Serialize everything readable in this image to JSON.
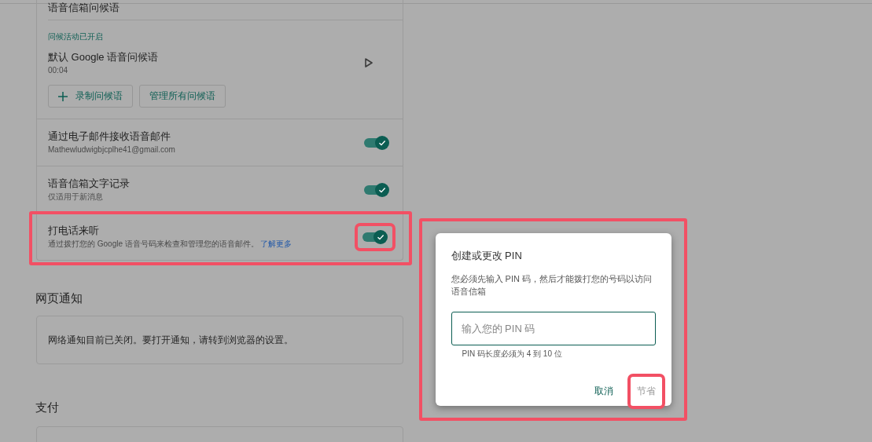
{
  "voicemail_card": {
    "greeting_title": "语音信箱问候语",
    "greeting_status": "问候活动已开启",
    "greeting": {
      "name": "默认 Google 语音问候语",
      "duration": "00:04"
    },
    "buttons": [
      {
        "kind": "add",
        "label": "录制问候语"
      },
      {
        "kind": "plain",
        "label": "管理所有问候语"
      }
    ],
    "settings": [
      {
        "title": "通过电子邮件接收语音邮件",
        "subtitle": "Mathewludwigbjcplhe41@gmail.com",
        "on": true,
        "highlighted": false
      },
      {
        "title": "语音信箱文字记录",
        "subtitle": "仅适用于新消息",
        "on": true,
        "highlighted": false
      },
      {
        "title": "打电话来听",
        "subtitle": "通过拨打您的 Google 语音号码来检查和管理您的语音邮件。",
        "link": "了解更多",
        "on": true,
        "highlighted": true
      }
    ]
  },
  "web_notifications": {
    "heading": "网页通知",
    "message": "网络通知目前已关闭。要打开通知，请转到浏览器的设置。"
  },
  "payments": {
    "heading": "支付"
  },
  "dialog": {
    "title": "创建或更改 PIN",
    "body": "您必须先输入 PIN 码，然后才能拨打您的号码以访问语音信箱",
    "placeholder": "输入您的 PIN 码",
    "hint": "PIN 码长度必须为 4 到 10 位",
    "highlighted": true,
    "actions": [
      {
        "label": "取消",
        "disabled": false,
        "highlighted": false
      },
      {
        "label": "节省",
        "disabled": true,
        "highlighted": true
      }
    ]
  }
}
